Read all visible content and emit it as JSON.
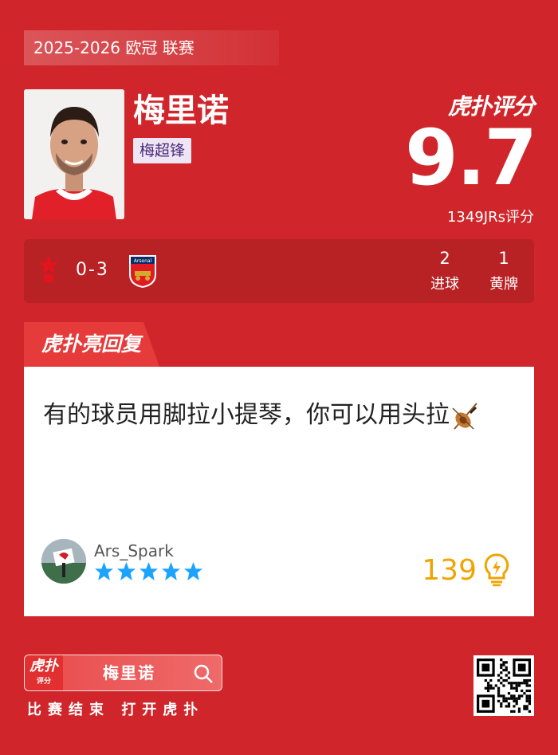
{
  "header": {
    "season": "2025-2026 欧冠 联赛"
  },
  "player": {
    "name": "梅里诺",
    "nickname": "梅超锋"
  },
  "rating": {
    "brand": "虎扑评分",
    "score": "9.7",
    "votes": "1349JRs评分"
  },
  "match": {
    "score": "0-3",
    "away_badge_text": "Arsenal",
    "stats": [
      {
        "value": "2",
        "label": "进球"
      },
      {
        "value": "1",
        "label": "黄牌"
      }
    ]
  },
  "reply": {
    "tab_label": "虎扑亮回复",
    "comment": "有的球员用脚拉小提琴，你可以用头拉",
    "username": "Ars_Spark",
    "stars": 5,
    "likes": "139"
  },
  "footer": {
    "logo_text": "虎扑",
    "logo_sub": "评分",
    "search_text": "梅里诺",
    "cta": "比赛结束 打开虎扑"
  },
  "colors": {
    "background": "#d0262b",
    "accent": "#f0a400",
    "star": "#1aa3ff"
  }
}
